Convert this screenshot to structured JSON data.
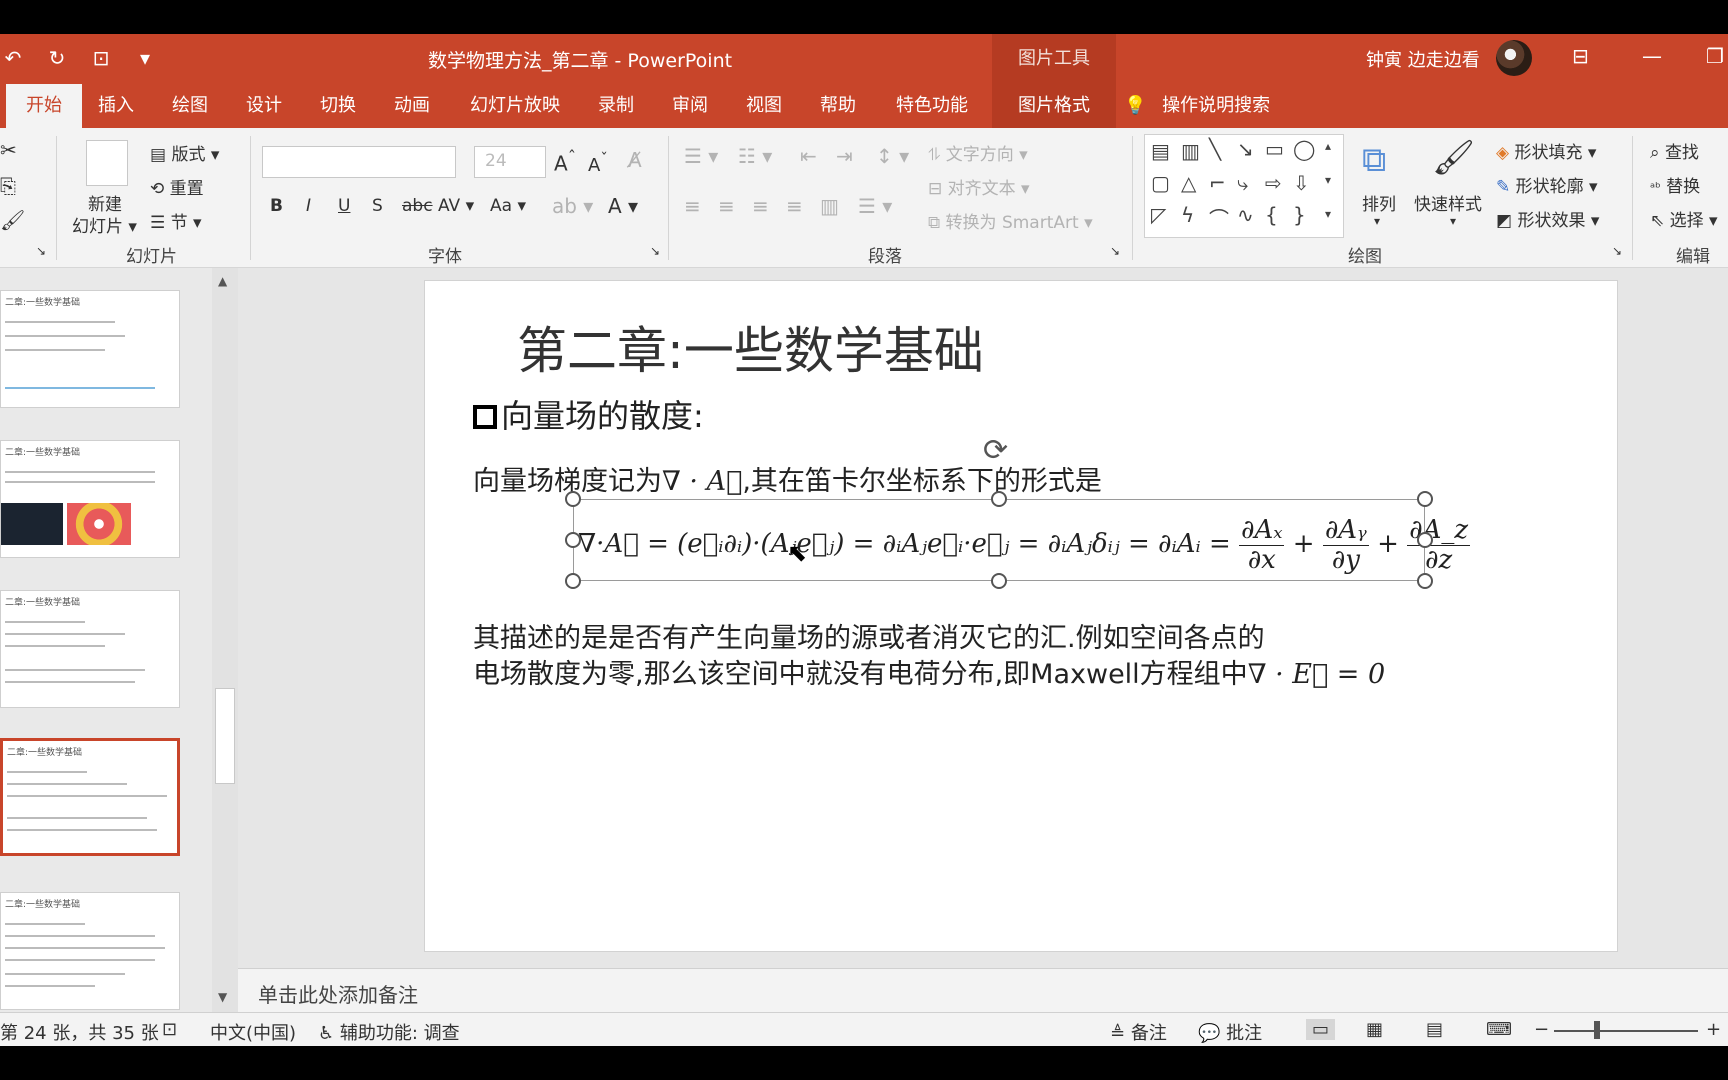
{
  "titlebar": {
    "doc_title": "数学物理方法_第二章 - PowerPoint",
    "context_tools": "图片工具",
    "user": "钟寅 边走边看"
  },
  "tabs": [
    "开始",
    "插入",
    "绘图",
    "设计",
    "切换",
    "动画",
    "幻灯片放映",
    "录制",
    "审阅",
    "视图",
    "帮助",
    "特色功能",
    "图片格式"
  ],
  "tell_me": "操作说明搜索",
  "ribbon": {
    "slides_group": {
      "label": "幻灯片",
      "new_slide": "新建",
      "new_slide_2": "幻灯片",
      "layout": "版式",
      "reset": "重置",
      "section": "节"
    },
    "font_group": {
      "label": "字体",
      "font_size": "24",
      "bold": "B",
      "italic": "I",
      "underline": "U",
      "shadow": "S",
      "strike": "abc",
      "spacing": "AV",
      "case": "Aa"
    },
    "paragraph_group": {
      "label": "段落",
      "text_direction": "文字方向",
      "align_text": "对齐文本",
      "smartart": "转换为 SmartArt"
    },
    "drawing_group": {
      "label": "绘图",
      "arrange": "排列",
      "quick_styles": "快速样式",
      "shape_fill": "形状填充",
      "shape_outline": "形状轮廓",
      "shape_effects": "形状效果"
    },
    "editing_group": {
      "label": "编辑",
      "find": "查找",
      "replace": "替换",
      "select": "选择"
    }
  },
  "thumbnails": [
    {
      "title": "二章:一些数学基础"
    },
    {
      "title": "二章:一些数学基础"
    },
    {
      "title": "二章:一些数学基础"
    },
    {
      "title": "二章:一些数学基础"
    },
    {
      "title": "二章:一些数学基础"
    }
  ],
  "slide": {
    "title": "第二章:一些数学基础",
    "bullet": "向量场的散度:",
    "line1_pre": "向量场梯度记为",
    "line1_math": "∇ · A⃗",
    "line1_post": ",其在笛卡尔坐标系下的形式是",
    "eq_main": "∇·A⃗ = (e⃗ᵢ∂ᵢ)·(Aⱼe⃗ⱼ) = ∂ᵢAⱼe⃗ᵢ·e⃗ⱼ = ∂ᵢAⱼδᵢⱼ = ∂ᵢAᵢ = ",
    "frac1_num": "∂Aₓ",
    "frac1_den": "∂x",
    "frac2_num": "∂Aᵧ",
    "frac2_den": "∂y",
    "frac3_num": "∂A_z",
    "frac3_den": "∂z",
    "para1": "其描述的是是否有产生向量场的源或者消灭它的汇.例如空间各点的",
    "para2_pre": "电场散度为零,那么该空间中就没有电荷分布,即Maxwell方程组中",
    "para2_math": "∇ · E⃗ = 0"
  },
  "notes_placeholder": "单击此处添加备注",
  "status": {
    "slide_count": "第 24 张，共 35 张",
    "language": "中文(中国)",
    "accessibility": "辅助功能: 调查",
    "notes": "备注",
    "comments": "批注"
  }
}
